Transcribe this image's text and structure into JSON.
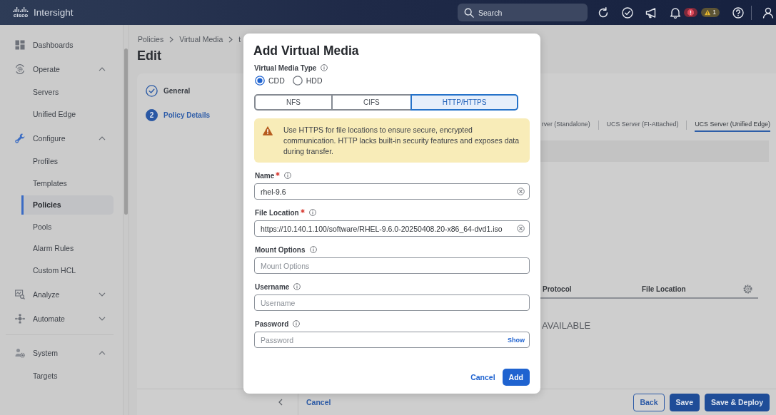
{
  "top_bar": {
    "logo_text": "cisco",
    "product": "Intersight",
    "search": {
      "placeholder": "Search"
    },
    "alerts": [
      {
        "kind": "critical"
      },
      {
        "kind": "warning",
        "count": "1"
      }
    ]
  },
  "sidebar": {
    "groups": [
      [
        {
          "label": "Dashboards",
          "kind": "link"
        },
        {
          "label": "Operate",
          "kind": "group",
          "expanded": true,
          "children": [
            {
              "label": "Servers",
              "selected": false
            },
            {
              "label": "Unified Edge",
              "selected": false
            }
          ]
        },
        {
          "label": "Configure",
          "kind": "group",
          "expanded": true,
          "children": [
            {
              "label": "Profiles",
              "selected": false
            },
            {
              "label": "Templates",
              "selected": false
            },
            {
              "label": "Policies",
              "selected": true
            },
            {
              "label": "Pools",
              "selected": false
            },
            {
              "label": "Alarm Rules",
              "selected": false
            },
            {
              "label": "Custom HCL",
              "selected": false
            }
          ]
        },
        {
          "label": "Analyze",
          "kind": "group",
          "expanded": false
        },
        {
          "label": "Automate",
          "kind": "group",
          "expanded": false
        }
      ],
      [
        {
          "label": "System",
          "kind": "group",
          "expanded": true,
          "children": [
            {
              "label": "Targets",
              "selected": false
            }
          ]
        }
      ]
    ]
  },
  "breadcrumb": [
    "Policies",
    "Virtual Media",
    "t"
  ],
  "page_title": "Edit",
  "wizard_steps": [
    {
      "label": "General",
      "done": true,
      "selected": false
    },
    {
      "label": "Policy Details",
      "number": "2",
      "done": false,
      "selected": true
    }
  ],
  "target_tabs": [
    {
      "label": "rver (Standalone)",
      "selected": false
    },
    {
      "label": "UCS Server (FI-Attached)",
      "selected": false
    },
    {
      "label": "UCS Server (Unified Edge)",
      "selected": true
    }
  ],
  "table": {
    "columns": [
      "Protocol",
      "File Location"
    ],
    "empty_text": "AVAILABLE"
  },
  "footer": {
    "cancel": "Cancel",
    "buttons": [
      {
        "label": "Back",
        "kind": "secondary"
      },
      {
        "label": "Save",
        "kind": "primary"
      },
      {
        "label": "Save & Deploy",
        "kind": "primary"
      }
    ]
  },
  "dialog": {
    "title": "Add Virtual Media",
    "media_type": {
      "label": "Virtual Media Type",
      "options": [
        {
          "label": "CDD",
          "selected": true
        },
        {
          "label": "HDD",
          "selected": false
        }
      ]
    },
    "protocols": [
      {
        "label": "NFS",
        "selected": false
      },
      {
        "label": "CIFS",
        "selected": false
      },
      {
        "label": "HTTP/HTTPS",
        "selected": true
      }
    ],
    "warning": "Use HTTPS for file locations to ensure secure, encrypted communication. HTTP lacks built-in security features and exposes data during transfer.",
    "fields": [
      {
        "label": "Name",
        "required": true,
        "value": "rhel-9.6"
      },
      {
        "label": "File Location",
        "required": true,
        "value": "https://10.140.1.100/software/RHEL-9.6.0-20250408.20-x86_64-dvd1.iso"
      },
      {
        "label": "Mount Options",
        "required": false,
        "placeholder": "Mount Options"
      },
      {
        "label": "Username",
        "required": false,
        "placeholder": "Username"
      },
      {
        "label": "Password",
        "required": false,
        "placeholder": "Password",
        "toggle": "Show"
      }
    ],
    "cancel": "Cancel",
    "submit": "Add"
  }
}
